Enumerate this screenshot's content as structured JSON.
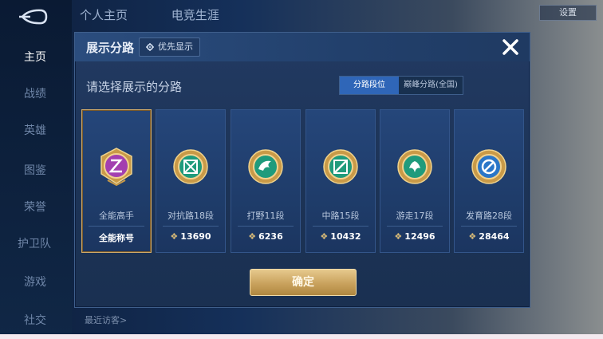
{
  "sidebar": {
    "items": [
      {
        "label": "主页",
        "active": true
      },
      {
        "label": "战绩"
      },
      {
        "label": "英雄"
      },
      {
        "label": "图鉴"
      },
      {
        "label": "荣誉"
      },
      {
        "label": "护卫队"
      },
      {
        "label": "游戏"
      },
      {
        "label": "社交"
      }
    ]
  },
  "top_tabs": [
    "个人主页",
    "电竞生涯"
  ],
  "top_right": {
    "settings_label": "设置"
  },
  "bottom": {
    "recent_visitors": "最近访客>"
  },
  "dialog": {
    "title": "展示分路",
    "priority_label": "优先显示",
    "prompt": "请选择展示的分路",
    "segments": [
      {
        "label": "分路段位",
        "active": true
      },
      {
        "label": "巅峰分路(全国)",
        "active": false
      }
    ],
    "cards": [
      {
        "name": "全能高手",
        "score": "全能称号",
        "selected": true,
        "icon": "all-round-emblem-icon",
        "color": "#a33fb0"
      },
      {
        "name": "对抗路18段",
        "score": "13690",
        "icon": "clash-lane-emblem-icon",
        "color": "#1f9b7c"
      },
      {
        "name": "打野11段",
        "score": "6236",
        "icon": "jungle-emblem-icon",
        "color": "#1f9b7c"
      },
      {
        "name": "中路15段",
        "score": "10432",
        "icon": "mid-lane-emblem-icon",
        "color": "#1f9b7c"
      },
      {
        "name": "游走17段",
        "score": "12496",
        "icon": "roam-emblem-icon",
        "color": "#1f9b7c"
      },
      {
        "name": "发育路28段",
        "score": "28464",
        "icon": "farm-lane-emblem-icon",
        "color": "#2a76c8"
      }
    ],
    "confirm_label": "确定"
  },
  "colors": {
    "accent_gold": "#d2ab68",
    "segment_active": "#2f66b8",
    "panel": "#1c3356"
  }
}
